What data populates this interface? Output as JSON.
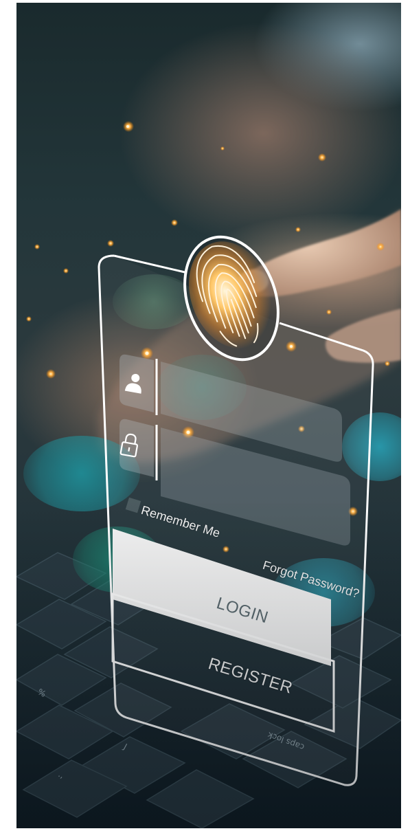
{
  "login_form": {
    "remember_me_label": "Remember Me",
    "forgot_password_label": "Forgot Password?",
    "login_label": "LOGIN",
    "register_label": "REGISTER"
  },
  "icons": [
    "fingerprint-icon",
    "user-icon",
    "lock-icon"
  ],
  "colors": {
    "background_dark": "#1b2a31",
    "line_white": "#ffffff",
    "glow_orange": "#ffb040",
    "bokeh_teal": "#1f8a96",
    "login_button_fill": "#f4f4f4"
  }
}
